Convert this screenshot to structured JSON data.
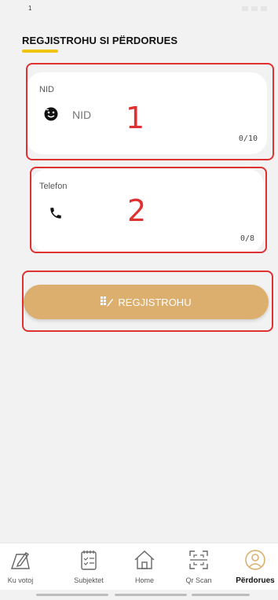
{
  "status_bar": {
    "time": "1"
  },
  "header": {
    "title": "REGJISTROHU SI PËRDORUES"
  },
  "form": {
    "nid": {
      "label": "NID",
      "placeholder": "NID",
      "value": "",
      "counter": "0/10",
      "icon": "face-id-icon"
    },
    "phone": {
      "label": "Telefon",
      "placeholder": "",
      "value": "",
      "counter": "0/8",
      "icon": "phone-icon"
    },
    "submit": {
      "label": "REGJISTROHU",
      "icon": "keypad-icon"
    }
  },
  "annotations": {
    "one": "1",
    "two": "2"
  },
  "bottom_nav": {
    "items": [
      {
        "label": "Ku votoj",
        "icon": "ballot-pen-icon",
        "active": false
      },
      {
        "label": "Subjektet",
        "icon": "notepad-checklist-icon",
        "active": false
      },
      {
        "label": "Home",
        "icon": "home-icon",
        "active": false
      },
      {
        "label": "Qr Scan",
        "icon": "qr-scan-icon",
        "active": false
      },
      {
        "label": "Përdorues",
        "icon": "user-icon",
        "active": true
      }
    ]
  },
  "colors": {
    "accent": "#dcaf6e",
    "underline": "#f1c40f",
    "annotation": "#e03131",
    "background": "#f2f2f2"
  }
}
